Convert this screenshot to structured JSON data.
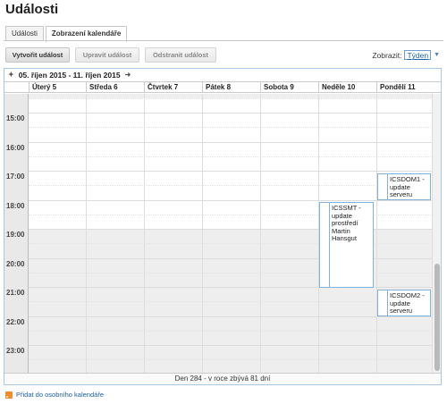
{
  "page": {
    "title": "Události"
  },
  "tabs": [
    {
      "label": "Události",
      "active": false
    },
    {
      "label": "Zobrazení kalendáře",
      "active": true
    }
  ],
  "toolbar": {
    "create_label": "Vytvořit událost",
    "edit_label": "Upravit událost",
    "delete_label": "Odstranit událost",
    "view_label": "Zobrazit:",
    "view_value": "Týden"
  },
  "calendar": {
    "range_label": "05. říjen 2015 - 11. říjen 2015",
    "days": [
      "Úterý 5",
      "Středa 6",
      "Čtvrtek 7",
      "Pátek 8",
      "Sobota 9",
      "Neděle 10",
      "Pondělí 11"
    ],
    "hours": [
      "15:00",
      "16:00",
      "17:00",
      "18:00",
      "19:00",
      "20:00",
      "21:00",
      "22:00",
      "23:00"
    ],
    "events": [
      {
        "text": "ICSDOM1 - update serveru"
      },
      {
        "text": "ICSSMT - update prostředí Martin Hansgut"
      },
      {
        "text": "ICSDOM2 - update serveru"
      }
    ],
    "status": "Den 284 - v roce zbývá 81 dní"
  },
  "footer": {
    "rss_label": "Přidat do osobního kalendáře"
  },
  "colors": {
    "accent": "#1a5fa8",
    "event_border": "#7fb2dc",
    "rss": "#f58a2a"
  }
}
